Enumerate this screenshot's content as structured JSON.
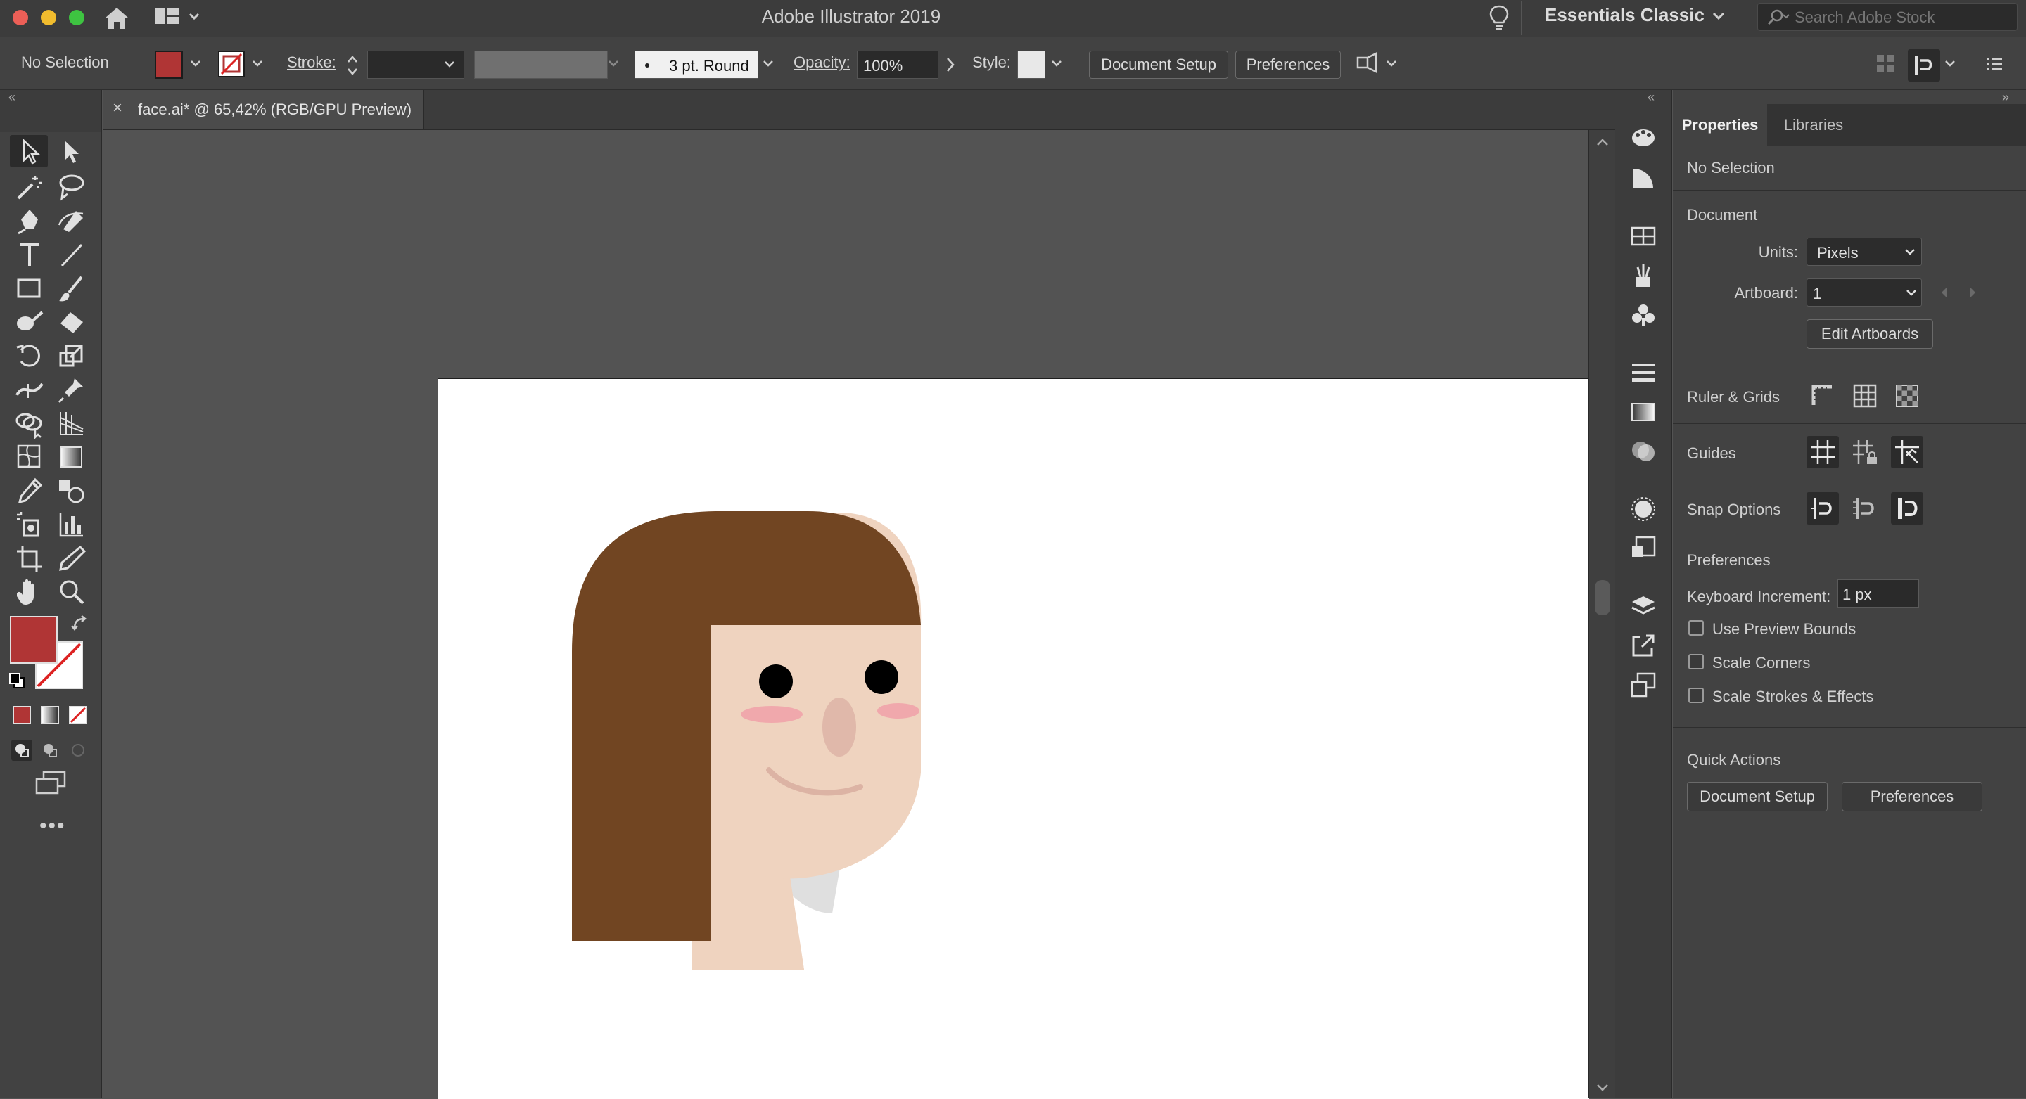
{
  "window": {
    "title": "Adobe Illustrator 2019"
  },
  "workspace": {
    "label": "Essentials Classic"
  },
  "search": {
    "placeholder": "Search Adobe Stock"
  },
  "control_bar": {
    "selection_status": "No Selection",
    "stroke_label": "Stroke:",
    "brush_label": "3 pt. Round",
    "opacity_label": "Opacity:",
    "opacity_value": "100%",
    "style_label": "Style:",
    "document_setup_button": "Document Setup",
    "preferences_button": "Preferences"
  },
  "document_tab": {
    "label": "face.ai* @ 65,42% (RGB/GPU Preview)"
  },
  "properties_panel": {
    "tabs": [
      "Properties",
      "Libraries"
    ],
    "selection_status": "No Selection",
    "document_heading": "Document",
    "units_label": "Units:",
    "units_value": "Pixels",
    "artboard_label": "Artboard:",
    "artboard_value": "1",
    "edit_artboards_button": "Edit Artboards",
    "ruler_grids_label": "Ruler & Grids",
    "guides_label": "Guides",
    "snap_options_label": "Snap Options",
    "preferences_heading": "Preferences",
    "keyboard_increment_label": "Keyboard Increment:",
    "keyboard_increment_value": "1 px",
    "checkboxes": [
      "Use Preview Bounds",
      "Scale Corners",
      "Scale Strokes & Effects"
    ],
    "quick_actions_heading": "Quick Actions",
    "quick_document_setup": "Document Setup",
    "quick_preferences": "Preferences"
  },
  "colors": {
    "fill": "#b03535",
    "hair": "#714522",
    "skin": "#efd3bf",
    "cheek": "#f0a8ac",
    "nose": "#e0b8aa",
    "smile": "#dcb3a4",
    "eye": "#000000",
    "neck_shadow": "#dfdfdf"
  }
}
